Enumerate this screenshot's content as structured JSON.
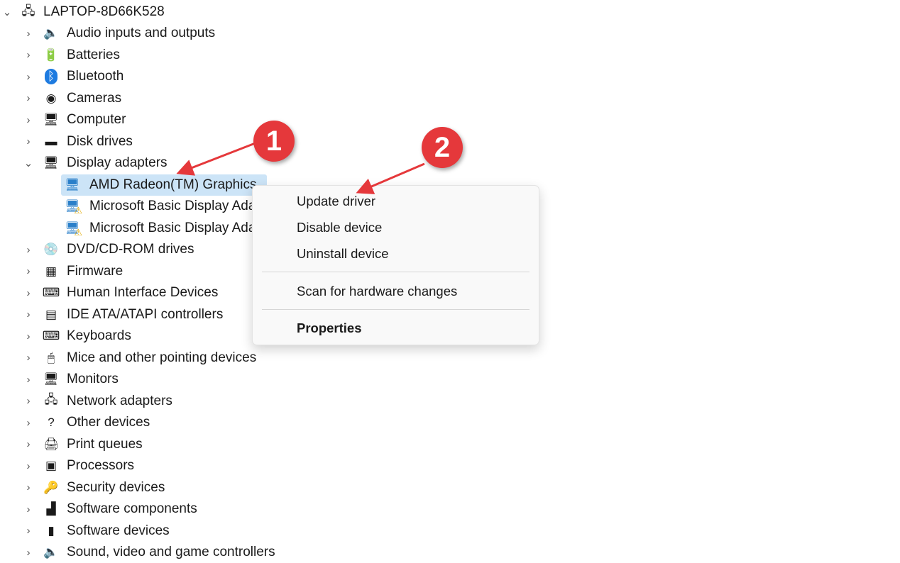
{
  "root": {
    "label": "LAPTOP-8D66K528",
    "icon": "computer-tower-icon"
  },
  "categories": [
    {
      "label": "Audio inputs and outputs",
      "icon": "speaker-icon"
    },
    {
      "label": "Batteries",
      "icon": "battery-plug-icon"
    },
    {
      "label": "Bluetooth",
      "icon": "bluetooth-icon"
    },
    {
      "label": "Cameras",
      "icon": "webcam-icon"
    },
    {
      "label": "Computer",
      "icon": "monitor-icon"
    },
    {
      "label": "Disk drives",
      "icon": "disk-drive-icon"
    },
    {
      "label": "Display adapters",
      "icon": "display-adapter-icon",
      "expanded": true,
      "children": [
        {
          "label": "AMD Radeon(TM) Graphics",
          "selected": true,
          "warning": false
        },
        {
          "label": "Microsoft Basic Display Adapter",
          "warning": true
        },
        {
          "label": "Microsoft Basic Display Adapter",
          "warning": true
        }
      ]
    },
    {
      "label": "DVD/CD-ROM drives",
      "icon": "dvd-drive-icon"
    },
    {
      "label": "Firmware",
      "icon": "firmware-chip-icon"
    },
    {
      "label": "Human Interface Devices",
      "icon": "hid-icon"
    },
    {
      "label": "IDE ATA/ATAPI controllers",
      "icon": "ide-controller-icon"
    },
    {
      "label": "Keyboards",
      "icon": "keyboard-icon"
    },
    {
      "label": "Mice and other pointing devices",
      "icon": "mouse-icon"
    },
    {
      "label": "Monitors",
      "icon": "monitor-icon"
    },
    {
      "label": "Network adapters",
      "icon": "network-adapter-icon"
    },
    {
      "label": "Other devices",
      "icon": "unknown-device-icon"
    },
    {
      "label": "Print queues",
      "icon": "printer-icon"
    },
    {
      "label": "Processors",
      "icon": "processor-icon"
    },
    {
      "label": "Security devices",
      "icon": "security-key-icon"
    },
    {
      "label": "Software components",
      "icon": "software-component-icon"
    },
    {
      "label": "Software devices",
      "icon": "software-device-icon"
    },
    {
      "label": "Sound, video and game controllers",
      "icon": "sound-controller-icon"
    }
  ],
  "context_menu": {
    "items": [
      "Update driver",
      "Disable device",
      "Uninstall device",
      "Scan for hardware changes",
      "Properties"
    ]
  },
  "annotations": {
    "step1": "1",
    "step2": "2",
    "color": "#e5383b"
  }
}
